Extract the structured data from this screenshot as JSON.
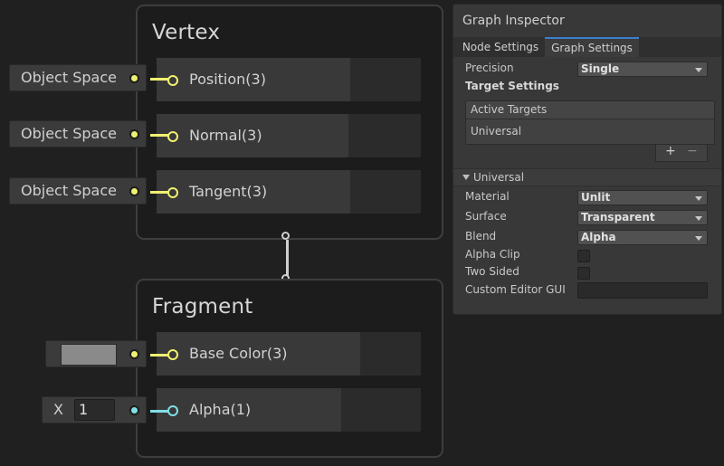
{
  "vertex": {
    "title": "Vertex",
    "slots": [
      {
        "label": "Position(3)",
        "input": "Object Space"
      },
      {
        "label": "Normal(3)",
        "input": "Object Space"
      },
      {
        "label": "Tangent(3)",
        "input": "Object Space"
      }
    ]
  },
  "fragment": {
    "title": "Fragment",
    "slots": [
      {
        "label": "Base Color(3)",
        "swatch_color": "#8a8a8a"
      },
      {
        "label": "Alpha(1)",
        "input_axis": "X",
        "input_value": "1"
      }
    ]
  },
  "colors": {
    "vector3_port": "#f0f070",
    "vector1_port": "#80e0e8",
    "tab_accent": "#3a7fd0"
  },
  "inspector": {
    "title": "Graph Inspector",
    "tabs": [
      {
        "label": "Node Settings",
        "active": false
      },
      {
        "label": "Graph Settings",
        "active": true
      }
    ],
    "precision": {
      "label": "Precision",
      "value": "Single"
    },
    "target_settings_label": "Target Settings",
    "active_targets": {
      "header": "Active Targets",
      "items": [
        "Universal"
      ],
      "add_glyph": "+",
      "remove_glyph": "−"
    },
    "universal": {
      "header": "Universal",
      "fields": [
        {
          "label": "Material",
          "type": "dropdown",
          "value": "Unlit"
        },
        {
          "label": "Surface",
          "type": "dropdown",
          "value": "Transparent"
        },
        {
          "label": "Blend",
          "type": "dropdown",
          "value": "Alpha"
        },
        {
          "label": "Alpha Clip",
          "type": "checkbox",
          "checked": false
        },
        {
          "label": "Two Sided",
          "type": "checkbox",
          "checked": false
        },
        {
          "label": "Custom Editor GUI",
          "type": "text",
          "value": ""
        }
      ]
    }
  }
}
